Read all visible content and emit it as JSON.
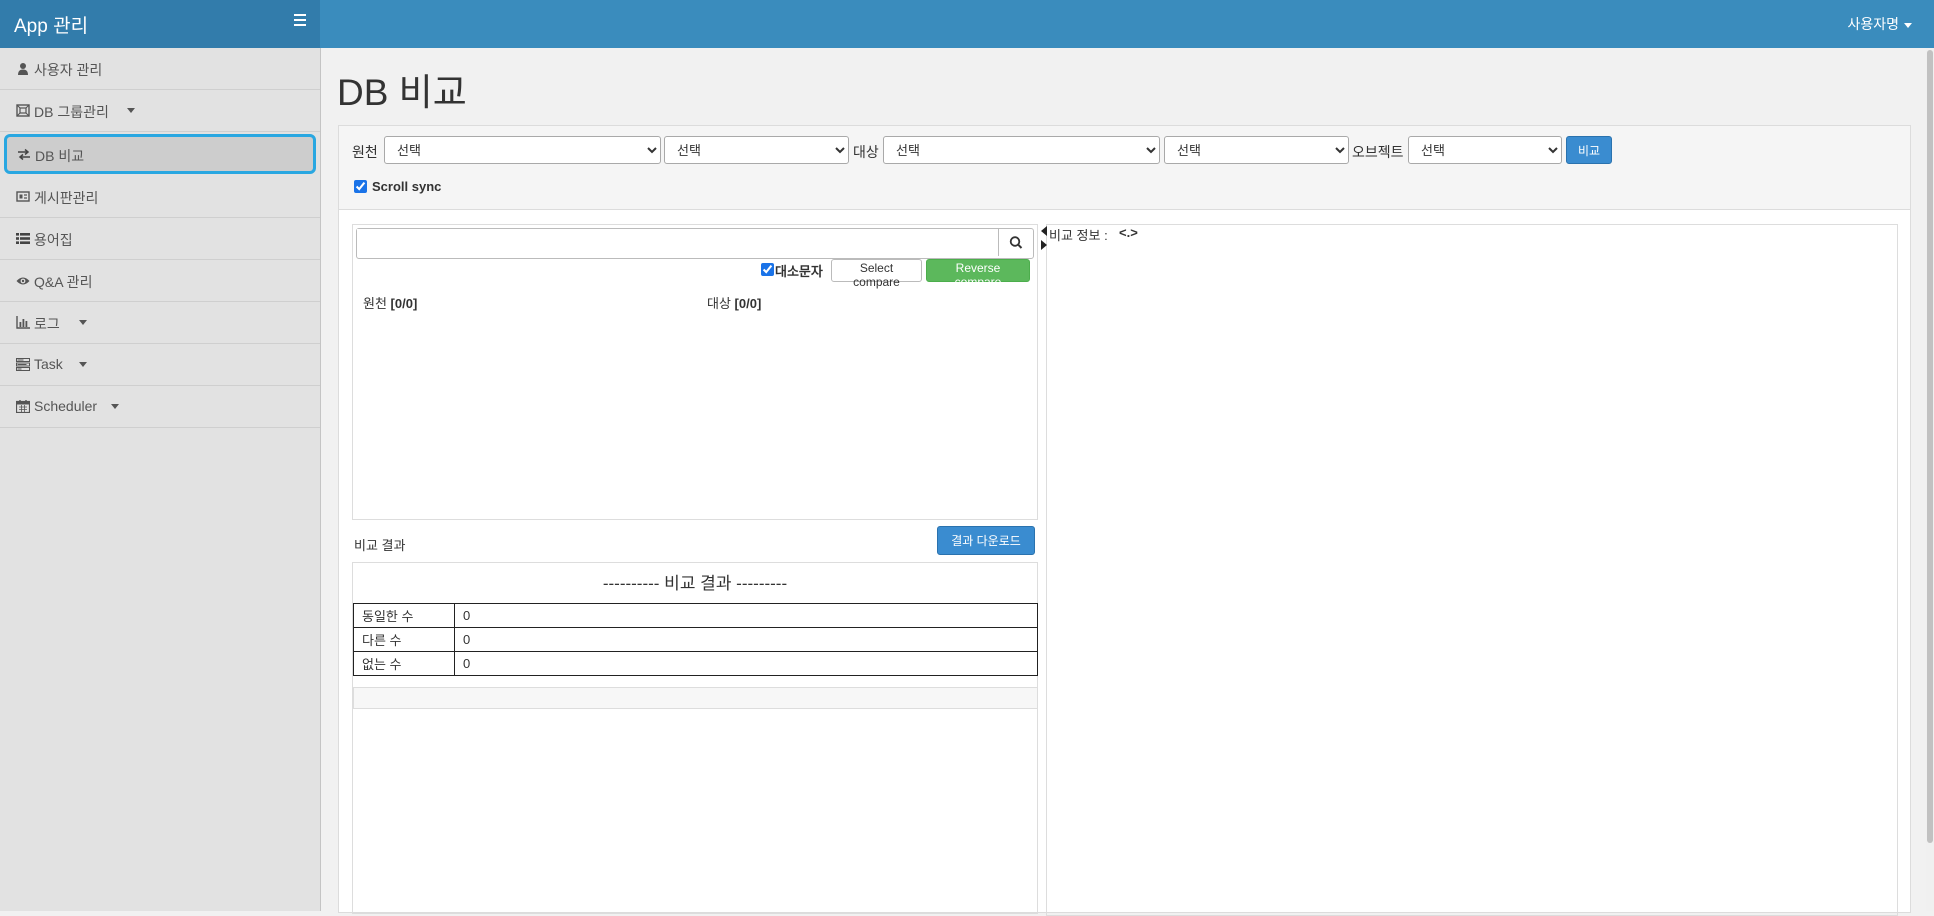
{
  "header": {
    "app_title": "App 관리",
    "menu_icon": "hamburger-icon",
    "user_name": "사용자명"
  },
  "sidebar": {
    "items": [
      {
        "label": "사용자 관리",
        "icon": "user-icon",
        "has_submenu": false
      },
      {
        "label": "DB 그룹관리",
        "icon": "db-group-icon",
        "has_submenu": true
      },
      {
        "label": "DB 비교",
        "icon": "exchange-icon",
        "has_submenu": false,
        "active": true
      },
      {
        "label": "게시판관리",
        "icon": "board-icon",
        "has_submenu": false
      },
      {
        "label": "용어집",
        "icon": "list-icon",
        "has_submenu": false
      },
      {
        "label": "Q&A 관리",
        "icon": "eye-icon",
        "has_submenu": false
      },
      {
        "label": "로그",
        "icon": "bar-chart-icon",
        "has_submenu": true
      },
      {
        "label": "Task",
        "icon": "tasks-icon",
        "has_submenu": true
      },
      {
        "label": "Scheduler",
        "icon": "calendar-icon",
        "has_submenu": true
      }
    ]
  },
  "page": {
    "title": "DB 비교"
  },
  "toolbar": {
    "source_label": "원천",
    "source_db_value": "선택",
    "source_schema_value": "선택",
    "target_label": "대상",
    "target_db_value": "선택",
    "target_schema_value": "선택",
    "object_label": "오브젝트",
    "object_value": "선택",
    "compare_button": "비교",
    "scroll_sync_label": "Scroll sync",
    "scroll_sync_checked": true
  },
  "compare": {
    "search_placeholder": "",
    "case_label": "대소문자",
    "case_checked": true,
    "select_compare_button": "Select compare",
    "reverse_compare_button": "Reverse compare",
    "source_header": "원천",
    "source_count": "[0/0]",
    "target_header": "대상",
    "target_count": "[0/0]"
  },
  "result": {
    "label": "비교 결과",
    "download_button": "결과 다운로드",
    "title": "---------- 비교 결과 ---------",
    "rows": [
      {
        "key": "동일한 수",
        "value": "0"
      },
      {
        "key": "다른 수",
        "value": "0"
      },
      {
        "key": "없는 수",
        "value": "0"
      }
    ]
  },
  "info": {
    "label": "비교 정보 :",
    "value": "<.>"
  },
  "colors": {
    "header_bg": "#3a8cbd",
    "brand_bg": "#327cab",
    "active_border": "#29a7e1",
    "primary_button": "#3a8cd0",
    "success_button": "#5cb85c"
  }
}
